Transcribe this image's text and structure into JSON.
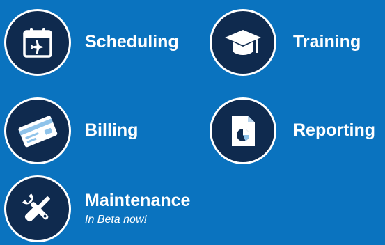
{
  "colors": {
    "background": "#0a73bf",
    "circle": "#0f2a4e",
    "text": "#ffffff"
  },
  "features": {
    "scheduling": {
      "label": "Scheduling",
      "icon": "calendar-plane-icon"
    },
    "training": {
      "label": "Training",
      "icon": "graduation-cap-icon"
    },
    "billing": {
      "label": "Billing",
      "icon": "credit-card-icon"
    },
    "reporting": {
      "label": "Reporting",
      "icon": "report-chart-icon"
    },
    "maintenance": {
      "label": "Maintenance",
      "sublabel": "In Beta now!",
      "icon": "wrench-screwdriver-icon"
    }
  }
}
